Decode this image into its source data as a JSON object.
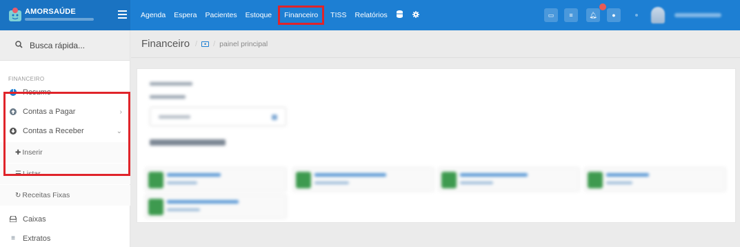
{
  "brand": {
    "name": "AMORSAÚDE",
    "tagline": "Centro de Saúde e Odontologia Popular"
  },
  "nav": {
    "items": [
      "Agenda",
      "Espera",
      "Pacientes",
      "Estoque",
      "Financeiro",
      "TISS",
      "Relatórios"
    ],
    "icons": [
      "database-icon",
      "gear-icon"
    ],
    "highlighted": "Financeiro"
  },
  "topbar_right": {
    "icons": [
      "monitor-icon",
      "list-icon",
      "bell-icon",
      "chat-icon"
    ],
    "notification_count": "",
    "user_name": ""
  },
  "sidebar": {
    "search_label": "Busca rápida...",
    "section_header": "FINANCEIRO",
    "items": [
      {
        "label": "Resumo",
        "icon": "pie-chart-icon"
      },
      {
        "label": "Contas a Pagar",
        "icon": "arrow-up-circle-icon"
      },
      {
        "label": "Contas a Receber",
        "icon": "arrow-down-circle-icon"
      },
      {
        "label": "Caixas",
        "icon": "cash-drawer-icon"
      },
      {
        "label": "Extratos",
        "icon": "list-icon"
      }
    ],
    "submenu": [
      {
        "label": "Inserir",
        "icon": "plus-icon"
      },
      {
        "label": "Listar",
        "icon": "list-icon"
      },
      {
        "label": "Receitas Fixas",
        "icon": "refresh-icon"
      }
    ]
  },
  "breadcrumb": {
    "title": "Financeiro",
    "separator": "/",
    "current": "painel principal"
  },
  "colors": {
    "topbar": "#1d7fd3",
    "highlight": "#e0242a",
    "card_badge": "#3e9a4f"
  }
}
